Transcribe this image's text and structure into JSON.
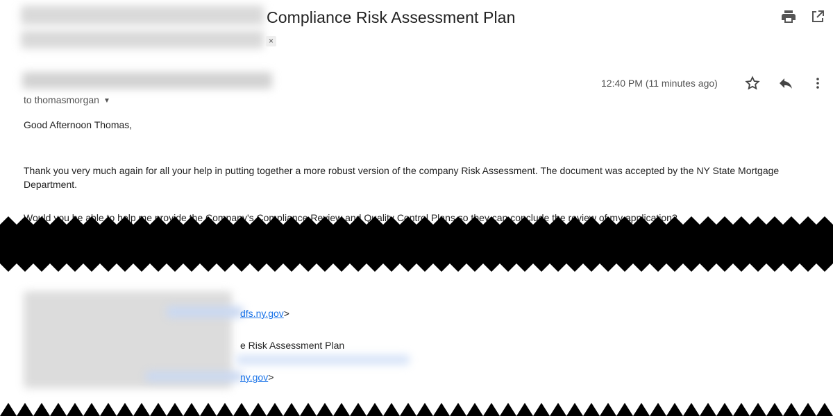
{
  "header": {
    "subject": "Compliance Risk Assessment Plan",
    "label_close": "×",
    "icons": {
      "print": "print-icon",
      "open_new": "open-in-new-icon"
    }
  },
  "message": {
    "timestamp": "12:40 PM (11 minutes ago)",
    "to": "to thomasmorgan",
    "to_caret": "▼",
    "icons": {
      "star": "star-icon",
      "reply": "reply-icon",
      "more": "more-vert-icon"
    },
    "greeting": "Good Afternoon Thomas,",
    "paragraph1": "Thank you very much again for all your help in putting together a more robust version of the company Risk Assessment. The document was accepted by the NY State Mortgage Department.",
    "paragraph2_partial": "Would you be able to help me provide the Company's Compliance Review and Quality Control Plans so they can conclude the review of my application?"
  },
  "quoted": {
    "from_link": "dfs.ny.gov",
    "from_suffix": ">",
    "subject_fragment": "e Risk Assessment Plan",
    "to_link": "ny.gov",
    "to_suffix": ">"
  }
}
